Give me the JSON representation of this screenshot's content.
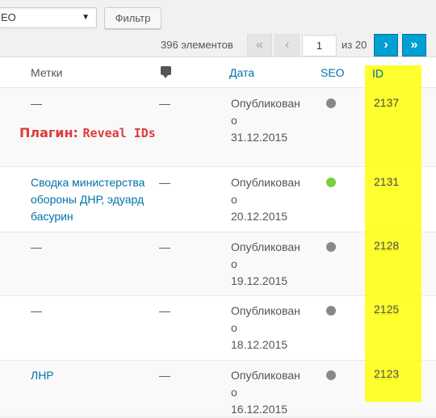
{
  "toolbar": {
    "seo_select_value": "EO",
    "filter_label": "Фильтр"
  },
  "pagination": {
    "item_count": "396 элементов",
    "first": "«",
    "prev": "‹",
    "current_page": "1",
    "of_total": "из 20",
    "next": "›",
    "last": "»"
  },
  "table": {
    "headers": {
      "tags": "Метки",
      "comments_icon": "comment-icon",
      "date": "Дата",
      "seo": "SEO",
      "id": "ID"
    },
    "rows": [
      {
        "tags": "—",
        "comments": "—",
        "date_status": "Опубликован",
        "date_o": "о",
        "date": "31.12.2015",
        "seo": "gray",
        "id": "2137"
      },
      {
        "tags": "Сводка министерства обороны ДНР, эдуард басурин",
        "comments": "—",
        "date_status": "Опубликован",
        "date_o": "о",
        "date": "20.12.2015",
        "seo": "green",
        "id": "2131"
      },
      {
        "tags": "—",
        "comments": "—",
        "date_status": "Опубликован",
        "date_o": "о",
        "date": "19.12.2015",
        "seo": "gray",
        "id": "2128"
      },
      {
        "tags": "—",
        "comments": "—",
        "date_status": "Опубликован",
        "date_o": "о",
        "date": "18.12.2015",
        "seo": "gray",
        "id": "2125"
      },
      {
        "tags": "ЛНР",
        "comments": "—",
        "date_status": "Опубликован",
        "date_o": "о",
        "date": "16.12.2015",
        "seo": "gray",
        "id": "2123"
      }
    ]
  },
  "annotation": {
    "plugin_label": "Плагин:",
    "plugin_name": "Reveal IDs"
  },
  "colors": {
    "link": "#0073aa",
    "highlight": "#ffff00",
    "annotation": "#dd3c3c",
    "seo_green": "#7ad03a",
    "seo_gray": "#888888"
  }
}
